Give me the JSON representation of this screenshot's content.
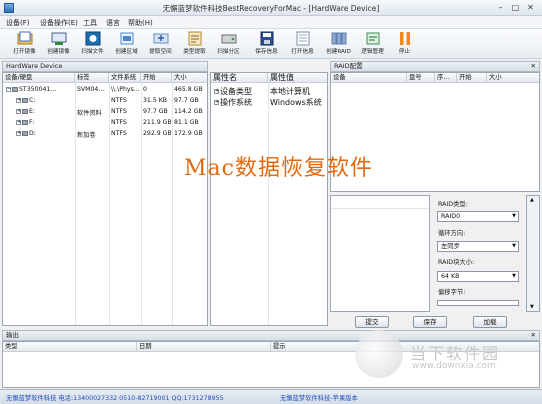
{
  "window": {
    "title": "无懈蓝梦软件科技BestRecoveryForMac - [HardWare Device]",
    "minimize": "–",
    "maximize": "□",
    "close": "✕"
  },
  "menu": [
    "设备(F)",
    "设备操作(E)",
    "工具",
    "语言",
    "帮助(H)"
  ],
  "toolbar": [
    {
      "label": "打开镜像",
      "icon": "open-image-icon",
      "color": "#3b73c4"
    },
    {
      "label": "创建镜像",
      "icon": "create-image-icon",
      "color": "#2f8a3b"
    },
    {
      "label": "扫描文件",
      "icon": "scan-files-icon",
      "color": "#1d6fb3"
    },
    {
      "label": "创建区域",
      "icon": "create-region-icon",
      "color": "#4a86c8"
    },
    {
      "label": "提取空间",
      "icon": "extract-space-icon",
      "color": "#5b8fc9"
    },
    {
      "label": "类型提取",
      "icon": "type-extract-icon",
      "color": "#b9892f"
    },
    {
      "label": "扫描分区",
      "icon": "scan-partition-icon",
      "color": "#6d6d6d"
    },
    {
      "label": "保存信息",
      "icon": "save-info-icon",
      "color": "#2b4f8e"
    },
    {
      "label": "打开信息",
      "icon": "open-info-icon",
      "color": "#7c8fa8"
    },
    {
      "label": "创建RAID",
      "icon": "create-raid-icon",
      "color": "#5f7fb0"
    },
    {
      "label": "逻辑管理",
      "icon": "logic-manage-icon",
      "color": "#3c8e52"
    },
    {
      "label": "停止",
      "icon": "stop-icon",
      "color": "#f08a1c"
    }
  ],
  "device_panel": {
    "header": "HardWare Device",
    "columns": [
      "设备/硬盘",
      "标签",
      "文件系统",
      "开始",
      "大小"
    ],
    "rows": [
      {
        "name": "ST350041...",
        "label": "SVM04...",
        "fs": "\\\\.\\Phys...",
        "start": "0",
        "size": "465.8 GB"
      },
      {
        "name": "C:",
        "label": "",
        "fs": "NTFS",
        "start": "31.5 KB",
        "size": "97.7 GB"
      },
      {
        "name": "E:",
        "label": "软件资料",
        "fs": "NTFS",
        "start": "97.7 GB",
        "size": "114.2 GB"
      },
      {
        "name": "F:",
        "label": "",
        "fs": "NTFS",
        "start": "211.9 GB",
        "size": "81.1 GB"
      },
      {
        "name": "D:",
        "label": "新加卷",
        "fs": "NTFS",
        "start": "292.9 GB",
        "size": "172.9 GB"
      }
    ]
  },
  "props_panel": {
    "columns": [
      "属性名",
      "属性值"
    ],
    "rows": [
      {
        "name": "设备类型",
        "value": "本地计算机"
      },
      {
        "name": "操作系统",
        "value": "Windows系统"
      }
    ]
  },
  "raid_panel": {
    "header": "RAID配置",
    "columns": [
      "设备",
      "盘号",
      "序...",
      "开始",
      "大小"
    ],
    "type_label": "RAID类型:",
    "type_value": "RAID0",
    "direction_label": "循环方向:",
    "direction_value": "左同步",
    "block_label": "RAID块大小:",
    "block_value": "64 KB",
    "offset_label": "偏移字节:",
    "submit": "提交",
    "save": "保存",
    "load": "加载"
  },
  "output_panel": {
    "header": "输出",
    "columns": [
      "类型",
      "日期",
      "提示"
    ]
  },
  "status": {
    "left": "无懈蓝梦软件科技 电话:13400027332 0510-82719001 QQ:1731278955",
    "right": "无懈蓝梦软件科技-苹果版本"
  },
  "overlay": {
    "caption": "Mac数据恢复软件",
    "watermark": "当下软件园",
    "watermark_url": "www.downxia.com"
  }
}
